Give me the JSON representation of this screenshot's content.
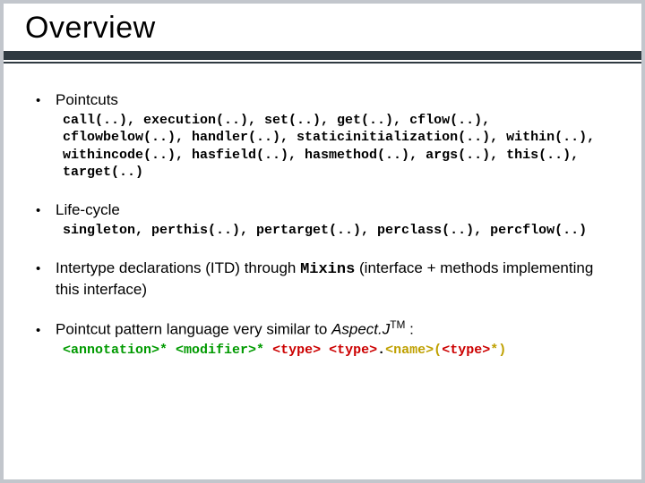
{
  "title": "Overview",
  "bullets": {
    "b1": {
      "label": "Pointcuts",
      "code": "call(..), execution(..), set(..), get(..), cflow(..), cflowbelow(..), handler(..), staticinitialization(..), within(..), withincode(..), hasfield(..), hasmethod(..), args(..), this(..), target(..)"
    },
    "b2": {
      "label": "Life-cycle",
      "code": "singleton, perthis(..), pertarget(..), perclass(..), percflow(..)"
    },
    "b3": {
      "pre": "Intertype declarations (ITD) through ",
      "mono": "Mixins",
      "post": " (interface + methods implementing this interface)"
    },
    "b4": {
      "pre": "Pointcut pattern language very similar to ",
      "italic": "Aspect.J",
      "tm": "TM",
      "colon": " :",
      "pattern": {
        "p1": "<annotation>*",
        "sp1": " ",
        "p2": "<modifier>*",
        "sp2": " ",
        "p3": "<type>",
        "sp3": " ",
        "p4": "<type>",
        "dot": ".",
        "p5": "<name>",
        "paren_open": "(",
        "p6": "<type>",
        "star": "*",
        "paren_close": ")"
      }
    }
  }
}
